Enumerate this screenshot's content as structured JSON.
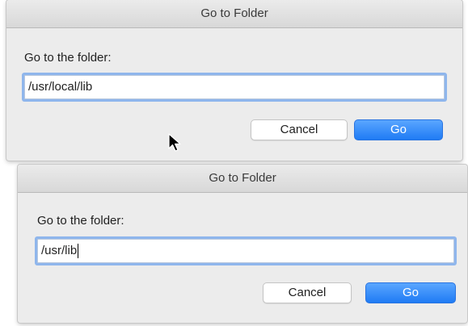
{
  "dialogs": [
    {
      "title": "Go to Folder",
      "prompt": "Go to the folder:",
      "path_value": "/usr/local/lib",
      "cancel_label": "Cancel",
      "go_label": "Go"
    },
    {
      "title": "Go to Folder",
      "prompt": "Go to the folder:",
      "path_value": "/usr/lib",
      "cancel_label": "Cancel",
      "go_label": "Go"
    }
  ],
  "colors": {
    "accent": "#1f7bf4",
    "focus_ring": "#8fb6ec",
    "dialog_bg": "#ececec"
  },
  "icons": {
    "pointer": "mouse-pointer-icon"
  }
}
